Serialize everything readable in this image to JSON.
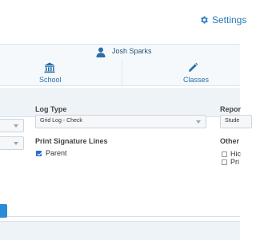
{
  "header": {
    "settings_label": "Settings"
  },
  "user": {
    "name": "Josh Sparks"
  },
  "nav": {
    "items": [
      {
        "label": "School",
        "icon": "school-building-icon"
      },
      {
        "label": "Classes",
        "icon": "pencil-icon"
      }
    ]
  },
  "form": {
    "log_type": {
      "label": "Log Type",
      "value": "Grid Log - Check"
    },
    "report": {
      "label": "Repor",
      "value": "Stude"
    },
    "print_signature": {
      "label": "Print Signature Lines",
      "options": [
        {
          "label": "Parent",
          "checked": true
        }
      ]
    },
    "other": {
      "label": "Other",
      "options": [
        {
          "label": "Hic",
          "checked": false
        },
        {
          "label": "Pri",
          "checked": false
        }
      ]
    }
  },
  "colors": {
    "link": "#2a7ab8",
    "accent_button": "#2a8bd8",
    "checkbox_on": "#1f6fd1"
  }
}
